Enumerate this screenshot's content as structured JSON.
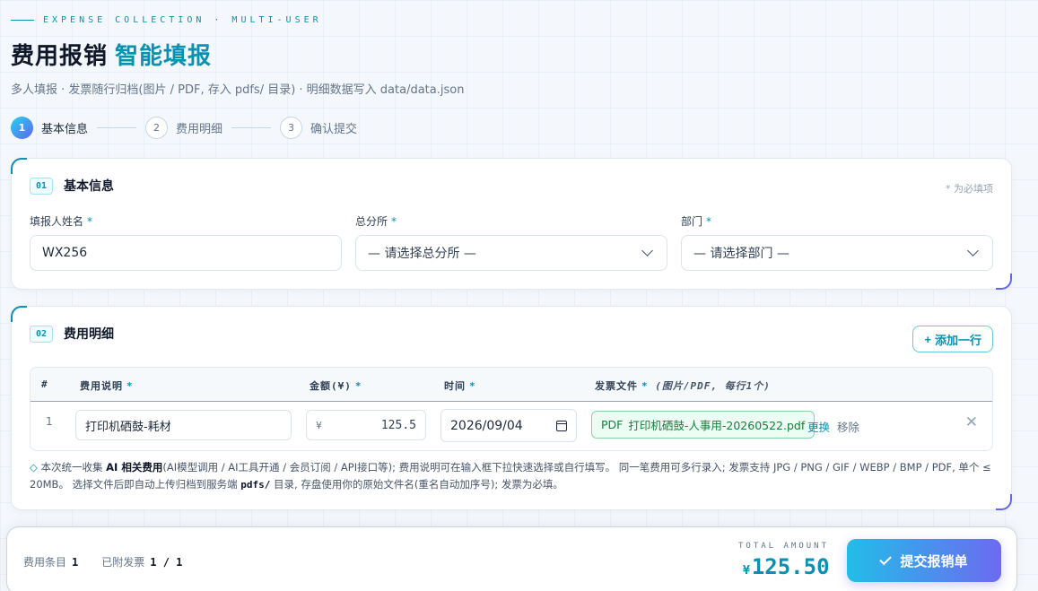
{
  "header": {
    "eyebrow": "EXPENSE COLLECTION · MULTI-USER",
    "title_main": "费用报销",
    "title_accent": "智能填报",
    "subtitle": "多人填报 · 发票随行归档(图片 / PDF, 存入 pdfs/ 目录) · 明细数据写入 data/data.json"
  },
  "steps": [
    {
      "num": "1",
      "label": "基本信息"
    },
    {
      "num": "2",
      "label": "费用明细"
    },
    {
      "num": "3",
      "label": "确认提交"
    }
  ],
  "basic_info": {
    "badge": "01",
    "title": "基本信息",
    "required_note": "* 为必填项",
    "required_mark": "*",
    "name_label": "填报人姓名",
    "name_value": "WX256",
    "branch_label": "总分所",
    "branch_value": "— 请选择总分所 —",
    "dept_label": "部门",
    "dept_value": "— 请选择部门 —"
  },
  "expense": {
    "badge": "02",
    "title": "费用明细",
    "add_row_label": "添加一行",
    "columns": {
      "idx": "#",
      "desc": "费用说明",
      "amount": "金额(¥)",
      "time": "时间",
      "file": "发票文件",
      "file_hint": "(图片/PDF, 每行1个)"
    },
    "rows": [
      {
        "idx": "1",
        "desc": "打印机硒鼓-耗材",
        "currency": "¥",
        "amount": "125.5",
        "date": "2026/09/04",
        "file_type": "PDF",
        "file_name": "打印机硒鼓-人事用-20260522.pdf",
        "replace_label": "更换",
        "remove_label": "移除"
      }
    ],
    "note": {
      "p1": "本次统一收集 ",
      "b1": "AI 相关费用",
      "p2": "(AI模型调用 / AI工具开通 / 会员订阅 / API接口等); 费用说明可在输入框下拉快速选择或自行填写。 同一笔费用可多行录入; 发票支持 JPG / PNG / GIF / WEBP / BMP / PDF, 单个 ≤ 20MB。 选择文件后即自动上传归档到服务端 ",
      "code": "pdfs/",
      "p3": " 目录, 存盘使用你的原始文件名(重名自动加序号); 发票为必填。"
    }
  },
  "footer": {
    "count_label": "费用条目",
    "count_value": "1",
    "attached_label": "已附发票",
    "attached_value": "1 / 1",
    "total_label": "TOTAL AMOUNT",
    "currency": "¥",
    "total_value": "125.50",
    "submit_label": "提交报销单"
  }
}
